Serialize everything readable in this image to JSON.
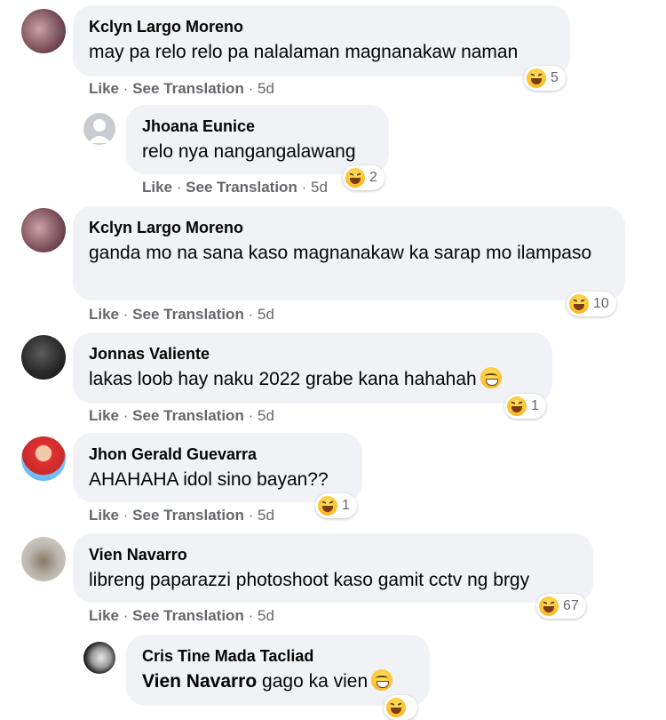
{
  "actions": {
    "like": "Like",
    "translate": "See Translation",
    "sep": "·"
  },
  "comments": [
    {
      "name": "Kclyn Largo Moreno",
      "text": "may pa relo relo pa nalalaman magnanakaw naman",
      "time": "5d",
      "reaction": "haha",
      "count": "5"
    },
    {
      "name": "Jhoana Eunice",
      "text": "relo nya nangangalawang",
      "time": "5d",
      "reaction": "haha",
      "count": "2"
    },
    {
      "name": "Kclyn Largo Moreno",
      "text": "ganda mo na sana kaso magnanakaw ka sarap mo ilampaso",
      "time": "5d",
      "reaction": "haha",
      "count": "10"
    },
    {
      "name": "Jonnas Valiente",
      "text": "lakas loob hay naku 2022 grabe kana hahahah",
      "time": "5d",
      "reaction": "haha",
      "count": "1"
    },
    {
      "name": "Jhon Gerald Guevarra",
      "text": "AHAHAHA idol sino bayan??",
      "time": "5d",
      "reaction": "haha",
      "count": "1"
    },
    {
      "name": "Vien Navarro",
      "text": "libreng paparazzi photoshoot kaso gamit cctv ng brgy",
      "time": "5d",
      "reaction": "haha",
      "count": "67"
    },
    {
      "name": "Cris Tine Mada Tacliad",
      "mention": "Vien Navarro",
      "text": "gago ka vien"
    }
  ],
  "colors": {
    "bubble": "#f0f2f5",
    "meta": "#65676b",
    "text": "#050505"
  }
}
